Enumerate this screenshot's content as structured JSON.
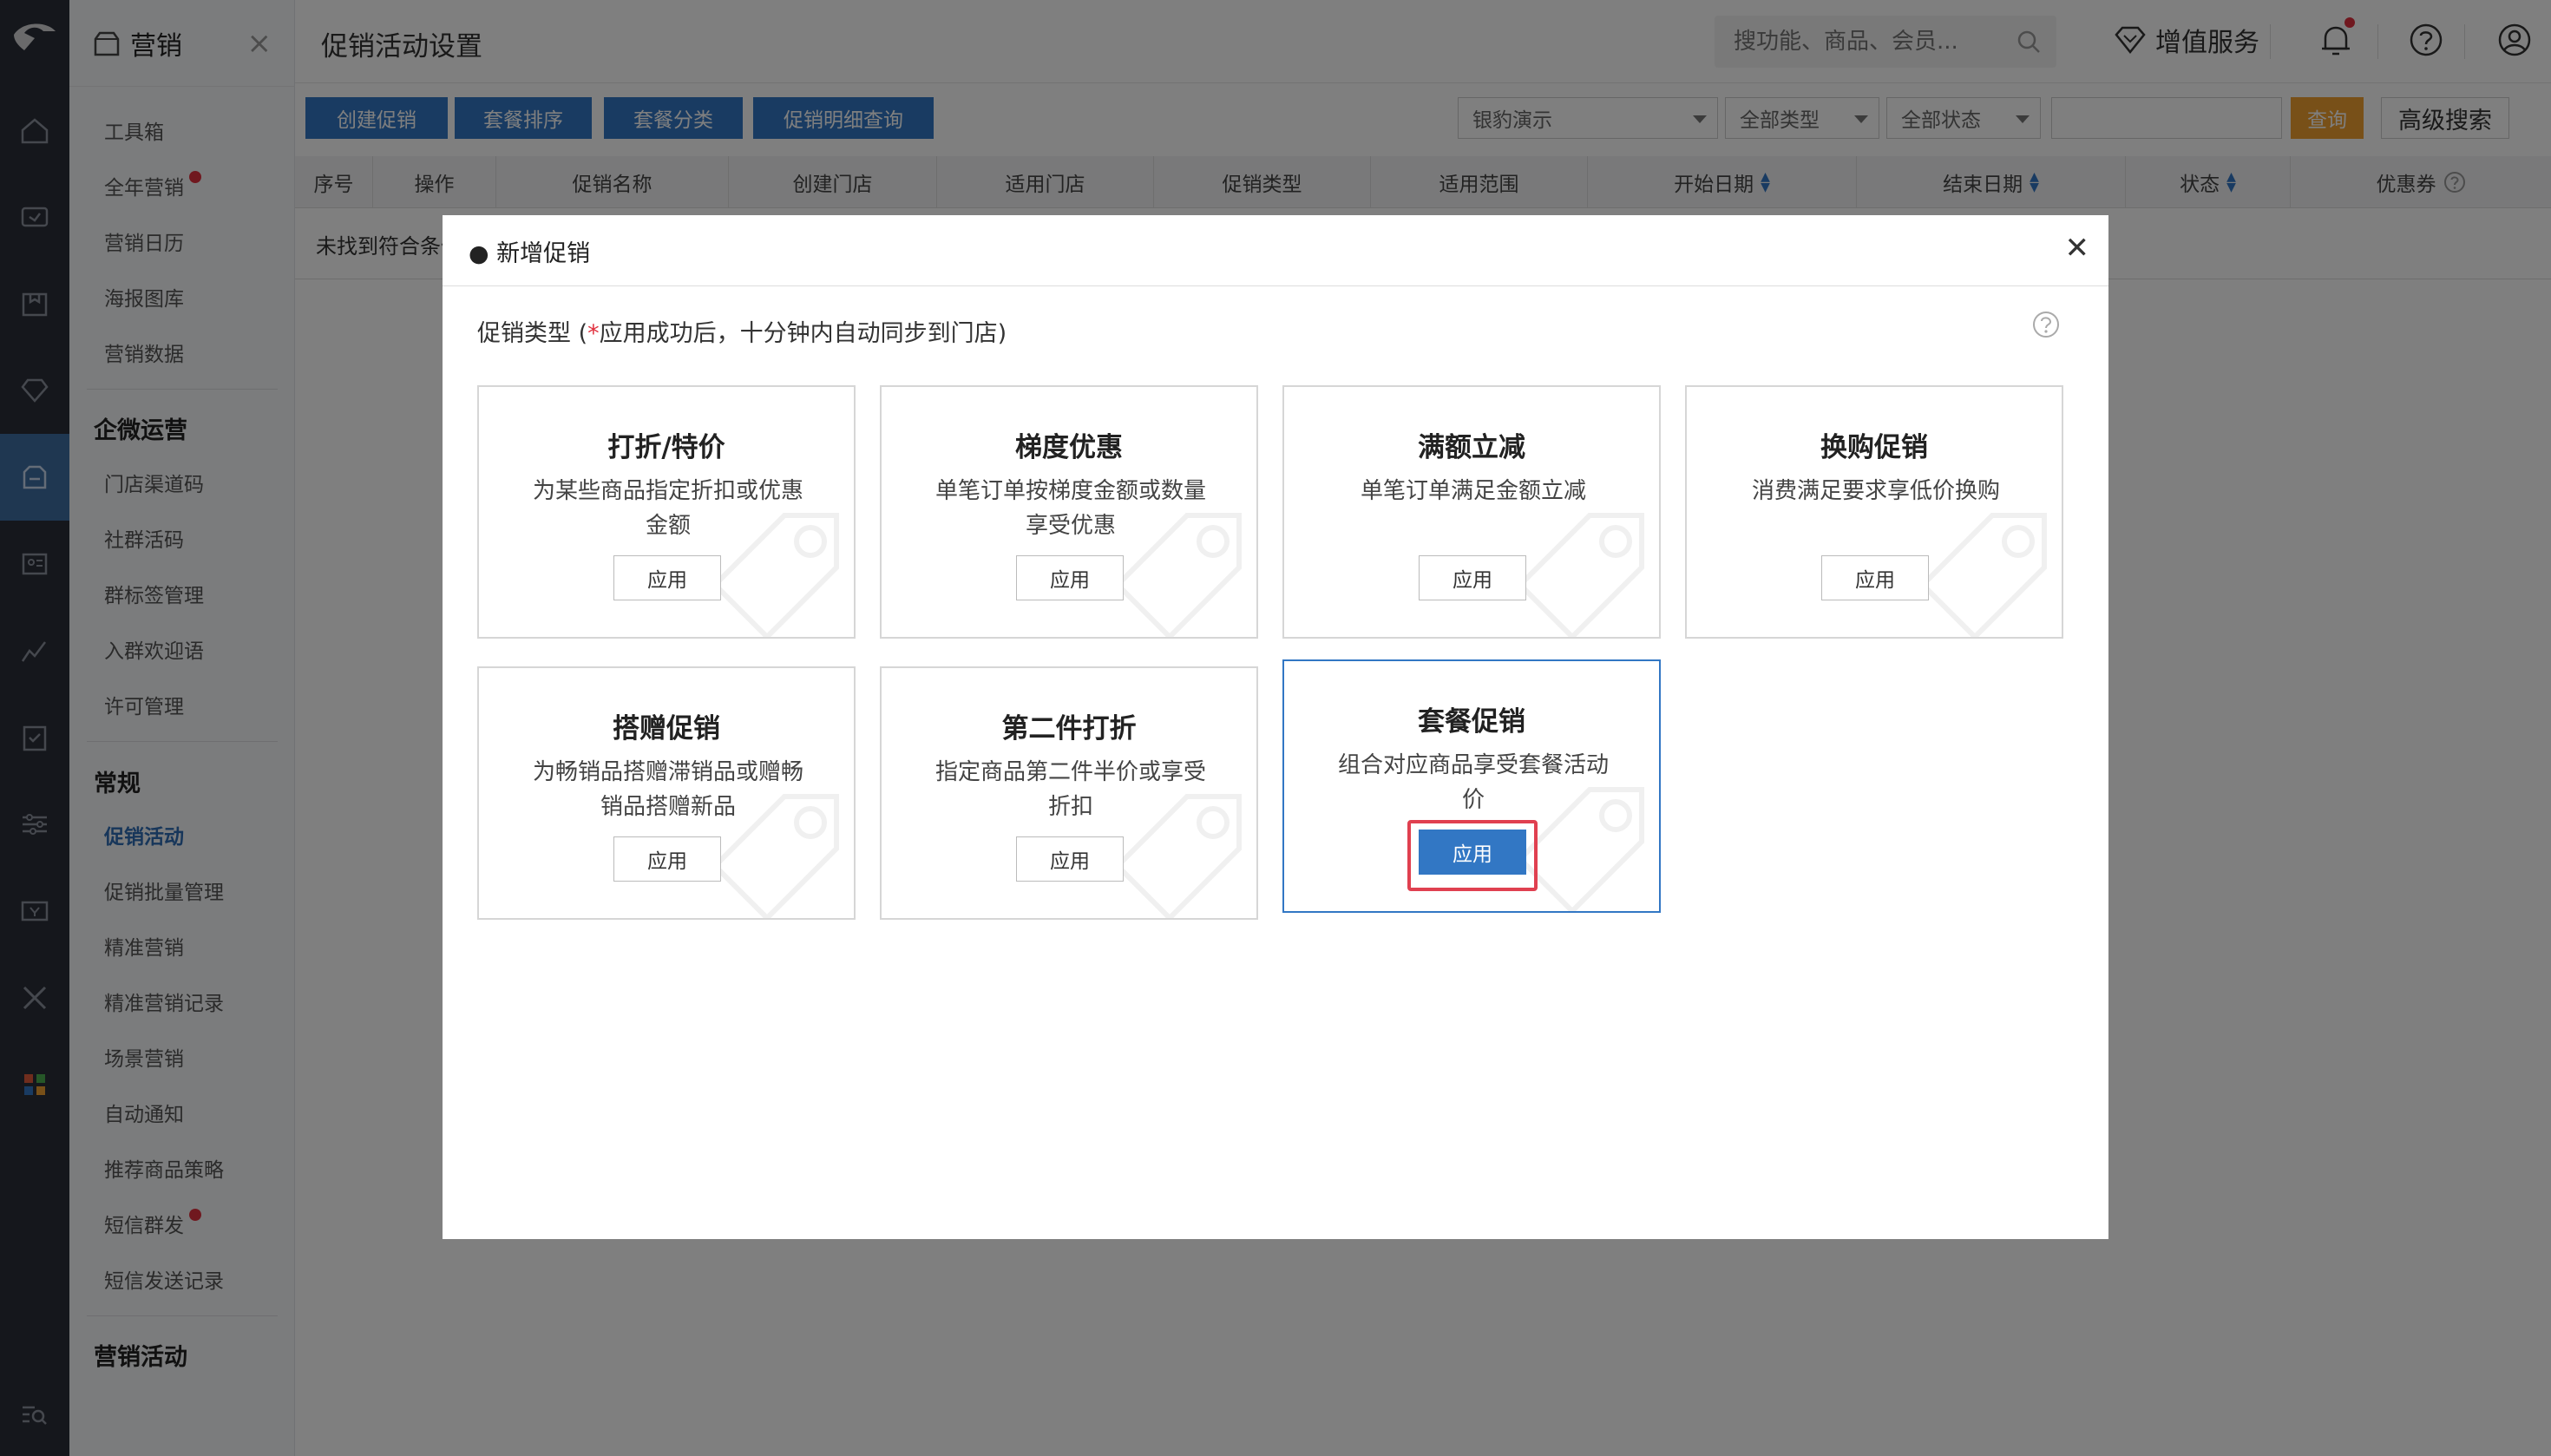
{
  "sidebar": {
    "header_title": "营销",
    "items_top": [
      "工具箱",
      "全年营销",
      "营销日历",
      "海报图库",
      "营销数据"
    ],
    "group_wecom": "企微运营",
    "items_wecom": [
      "门店渠道码",
      "社群活码",
      "群标签管理",
      "入群欢迎语",
      "许可管理"
    ],
    "group_general": "常规",
    "items_general": [
      "促销活动",
      "促销批量管理",
      "精准营销",
      "精准营销记录",
      "场景营销",
      "自动通知",
      "推荐商品策略",
      "短信群发",
      "短信发送记录"
    ],
    "group_activity": "营销活动"
  },
  "header": {
    "page_title": "促销活动设置",
    "search_placeholder": "搜功能、商品、会员...",
    "value_added": "增值服务"
  },
  "toolbar": {
    "buttons": [
      "创建促销",
      "套餐排序",
      "套餐分类",
      "促销明细查询"
    ],
    "store_select": "银豹演示",
    "type_select": "全部类型",
    "status_select": "全部状态",
    "query": "查询",
    "advanced": "高级搜索"
  },
  "table": {
    "columns": [
      "序号",
      "操作",
      "促销名称",
      "创建门店",
      "适用门店",
      "促销类型",
      "适用范围",
      "开始日期",
      "结束日期",
      "状态",
      "优惠券"
    ],
    "empty_text": "未找到符合条件的记录"
  },
  "modal": {
    "title": "● 新增促销",
    "subtitle_label": "促销类型 (",
    "subtitle_required": "*",
    "subtitle_note": "应用成功后，十分钟内自动同步到门店)",
    "cards": [
      {
        "title": "打折/特价",
        "desc": "为某些商品指定折扣或优惠金额",
        "button": "应用"
      },
      {
        "title": "梯度优惠",
        "desc": "单笔订单按梯度金额或数量享受优惠",
        "button": "应用"
      },
      {
        "title": "满额立减",
        "desc": "单笔订单满足金额立减",
        "button": "应用"
      },
      {
        "title": "换购促销",
        "desc": "消费满足要求享低价换购",
        "button": "应用"
      },
      {
        "title": "搭赠促销",
        "desc": "为畅销品搭赠滞销品或赠畅销品搭赠新品",
        "button": "应用"
      },
      {
        "title": "第二件打折",
        "desc": "指定商品第二件半价或享受折扣",
        "button": "应用"
      },
      {
        "title": "套餐促销",
        "desc": "组合对应商品享受套餐活动价",
        "button": "应用"
      }
    ]
  },
  "colors": {
    "primary": "#3277c4",
    "accent": "#f0a030",
    "highlight": "#e04050",
    "rail": "#2b2f38"
  }
}
